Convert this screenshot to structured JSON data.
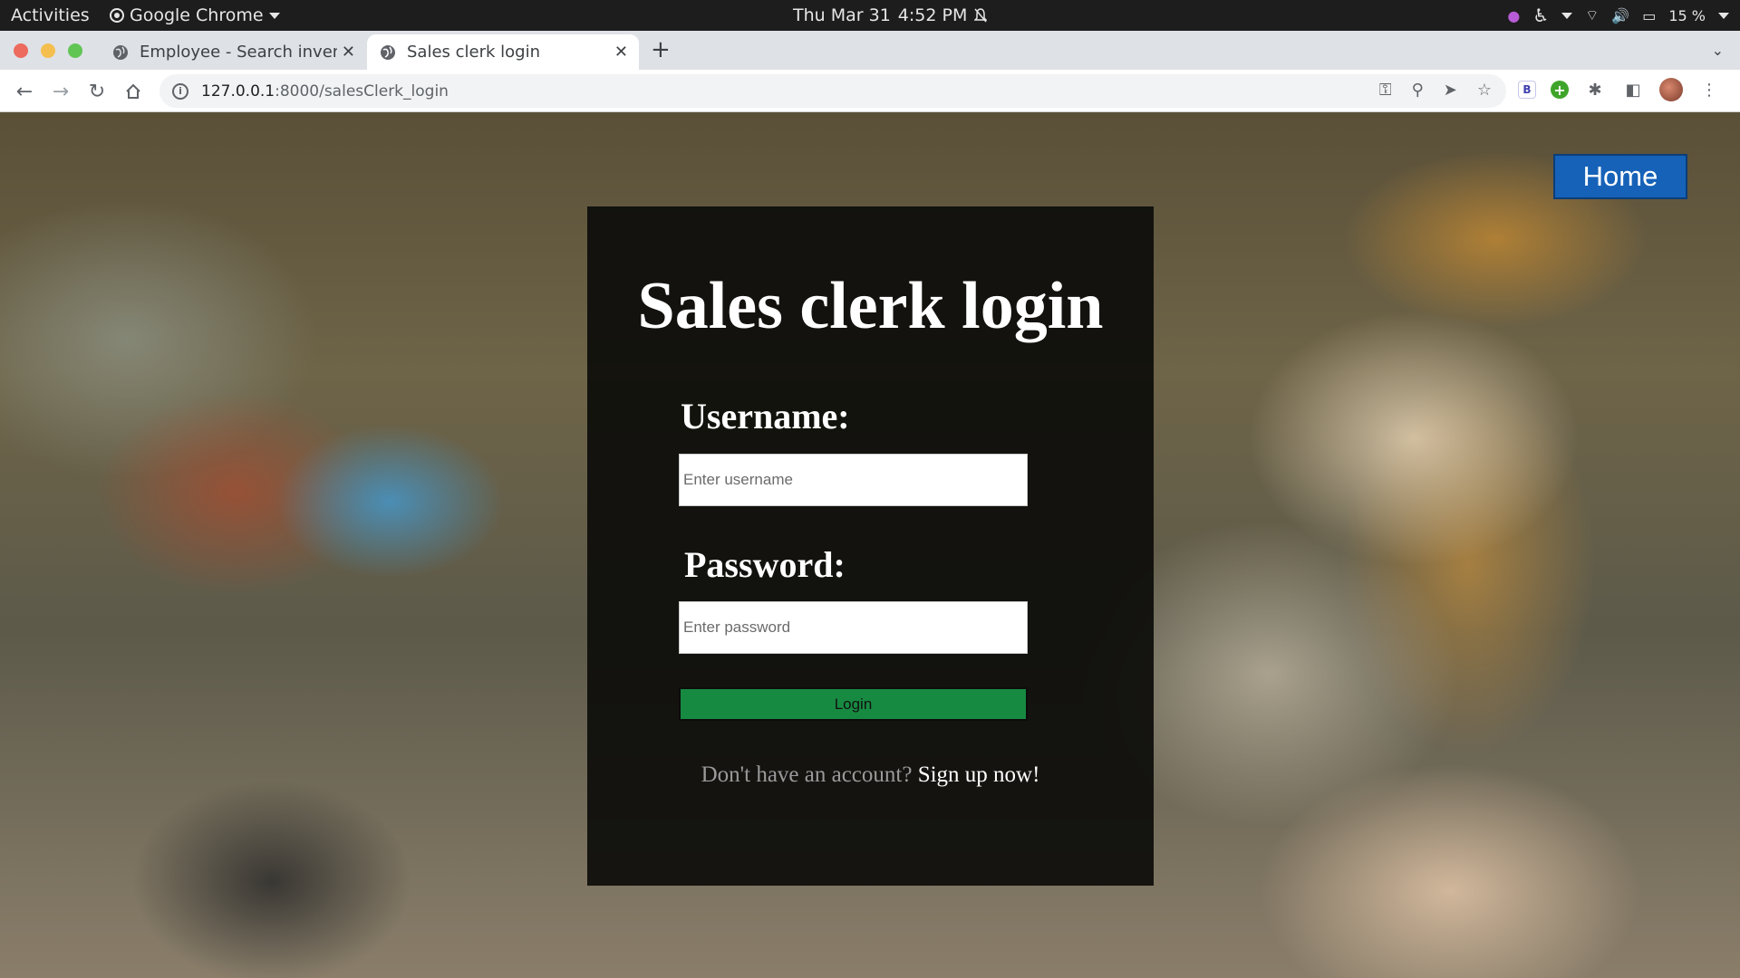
{
  "os_bar": {
    "activities": "Activities",
    "app_name": "Google Chrome",
    "date": "Thu Mar 31",
    "time": "4:52 PM",
    "battery": "15 %"
  },
  "browser": {
    "tabs": [
      {
        "title": "Employee - Search invento",
        "active": false
      },
      {
        "title": "Sales clerk login",
        "active": true
      }
    ],
    "url_host": "127.0.0.1",
    "url_path": ":8000/salesClerk_login",
    "extension_b_label": "B",
    "traffic_colors": [
      "#ed6a5e",
      "#f5bf4f",
      "#61c554"
    ]
  },
  "page": {
    "home_button": "Home",
    "title": "Sales clerk login",
    "username_label": "Username:",
    "username_placeholder": "Enter username",
    "password_label": "Password:",
    "password_placeholder": "Enter password",
    "login_button": "Login",
    "signup_prompt": "Don't have an account?",
    "signup_link": "Sign up now!",
    "colors": {
      "home_button": "#1662b8",
      "login_button": "#178a41",
      "card_bg": "#0c0c0a"
    }
  }
}
